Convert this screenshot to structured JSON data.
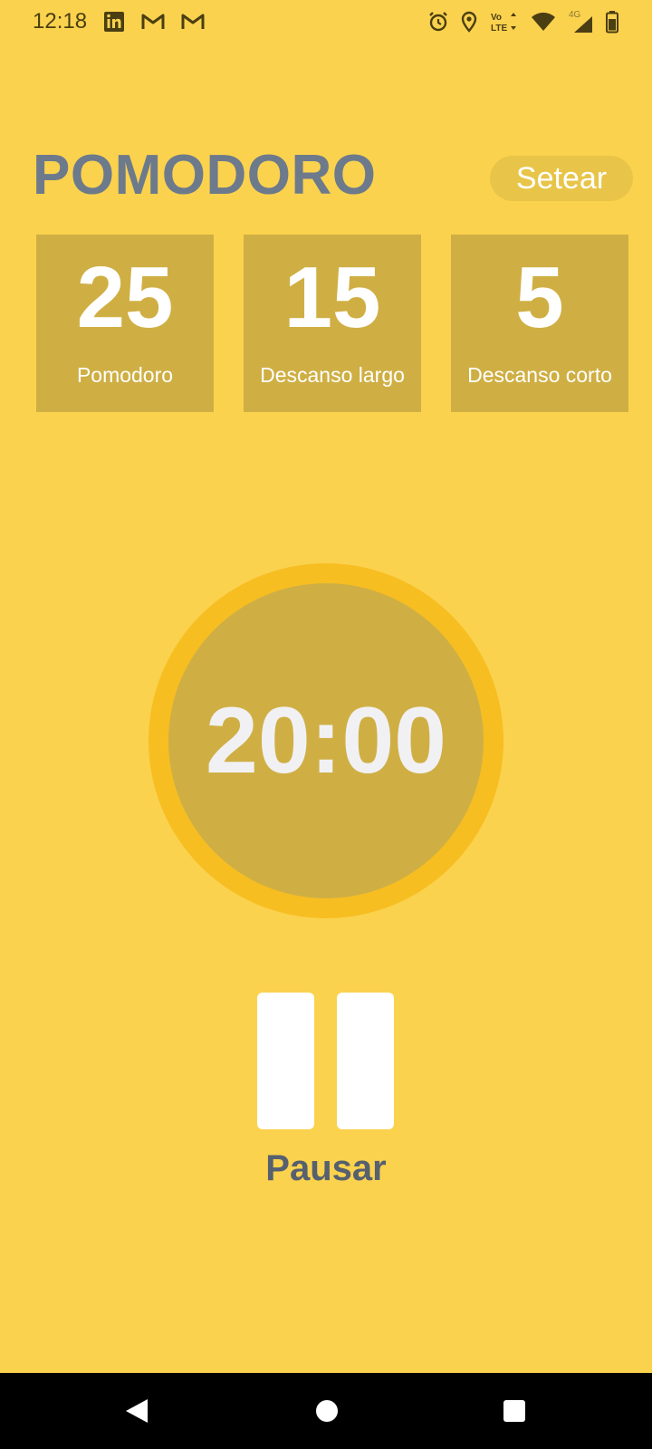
{
  "status_bar": {
    "time": "12:18",
    "left_icons": [
      "linkedin-icon",
      "gmail-icon",
      "gmail-icon"
    ],
    "right_icons": [
      "alarm-icon",
      "location-icon",
      "volte-icon",
      "wifi-icon",
      "signal-4g-icon",
      "battery-icon"
    ],
    "network_label": "4G",
    "volte_label": "Vo LTE"
  },
  "header": {
    "title": "POMODORO",
    "set_button_label": "Setear"
  },
  "tiles": [
    {
      "value": "25",
      "label": "Pomodoro"
    },
    {
      "value": "15",
      "label": "Descanso largo"
    },
    {
      "value": "5",
      "label": "Descanso corto"
    }
  ],
  "timer": {
    "display": "20:00"
  },
  "control": {
    "icon": "pause-icon",
    "label": "Pausar"
  },
  "nav_bar": {
    "icons": [
      "back-icon",
      "home-icon",
      "recents-icon"
    ]
  },
  "colors": {
    "background": "#FBD24E",
    "tile": "#CFAF44",
    "ring": "#F7BE22",
    "title": "#6C7A8C",
    "label": "#56606E"
  }
}
